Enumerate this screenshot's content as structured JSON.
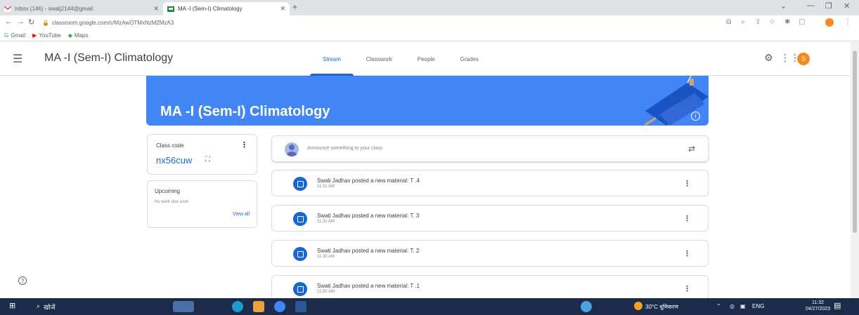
{
  "browser": {
    "tabs": [
      {
        "title": "Inbox (146) - swatj2144@gmail.",
        "close": "✕"
      },
      {
        "title": "MA -I (Sem-I) Climatology",
        "close": "✕"
      }
    ],
    "new_tab": "+",
    "url": "classroom.google.com/c/MzAwOTMxNzM2MzA3",
    "bookmarks": [
      {
        "label": "Gmail",
        "icon": "google-icon"
      },
      {
        "label": "YouTube",
        "icon": "youtube-icon"
      },
      {
        "label": "Maps",
        "icon": "maps-icon"
      }
    ]
  },
  "header": {
    "title": "MA -I (Sem-I) Climatology",
    "tabs": [
      "Stream",
      "Classwork",
      "People",
      "Grades"
    ],
    "active_tab": "Stream",
    "avatar_letter": "S"
  },
  "banner": {
    "title": "MA -I (Sem-I) Climatology",
    "info": "i"
  },
  "class_code": {
    "label": "Class code",
    "value": "nx56cuw"
  },
  "upcoming": {
    "label": "Upcoming",
    "empty": "No work due soon",
    "view_all": "View all"
  },
  "announce": {
    "placeholder": "Announce something to your class"
  },
  "posts": [
    {
      "text": "Swati Jadhav posted a new material: T .4",
      "time": "11:31 AM"
    },
    {
      "text": "Swati Jadhav posted a new material: T. 3",
      "time": "11:31 AM"
    },
    {
      "text": "Swati Jadhav posted a new material: T. 2",
      "time": "11:30 AM"
    },
    {
      "text": "Swati Jadhav posted a new material: T .1",
      "time": "11:30 AM"
    }
  ],
  "taskbar": {
    "search": "खोजें",
    "weather": "30°C  धूमिकरण",
    "lang": "ENG",
    "time": "11:32",
    "date": "04/27/2023"
  },
  "colors": {
    "accent": "#1967d2",
    "banner": "#4285f4",
    "avatar": "#f48b1e",
    "taskbar": "#1c2b4a"
  }
}
